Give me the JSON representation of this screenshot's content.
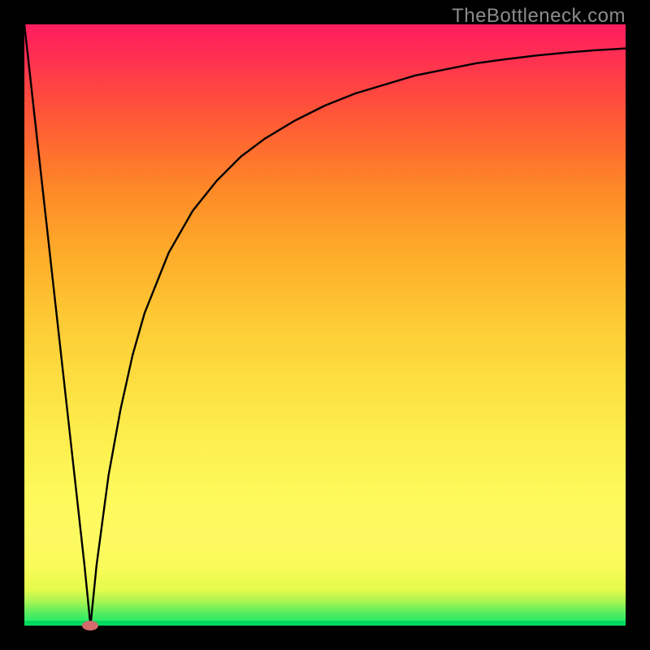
{
  "watermark": "TheBottleneck.com",
  "colors": {
    "frame": "#000000",
    "curve": "#000000",
    "marker": "#d46a6d",
    "watermark": "#8b8b8b"
  },
  "chart_data": {
    "type": "line",
    "title": "",
    "xlabel": "",
    "ylabel": "",
    "xlim": [
      0,
      100
    ],
    "ylim": [
      0,
      100
    ],
    "legend": false,
    "grid": false,
    "description": "Bottleneck-style V-curve. Value is 100 at x=0, 0 at x≈11, then rises asymptotically toward ~96 at x=100. Background is green→yellow→red vertical gradient.",
    "minimum_at_x": 11,
    "series": [
      {
        "name": "curve",
        "x": [
          0,
          2,
          4,
          6,
          8,
          10,
          11,
          12,
          14,
          16,
          18,
          20,
          24,
          28,
          32,
          36,
          40,
          45,
          50,
          55,
          60,
          65,
          70,
          75,
          80,
          85,
          90,
          95,
          100
        ],
        "y": [
          100,
          82,
          64,
          46,
          28,
          10,
          0,
          10,
          25,
          36,
          45,
          52,
          62,
          69,
          74,
          78,
          81,
          84,
          86.5,
          88.5,
          90,
          91.5,
          92.5,
          93.5,
          94.2,
          94.8,
          95.3,
          95.7,
          96
        ]
      }
    ],
    "marker": {
      "x": 11,
      "y": 0
    }
  }
}
